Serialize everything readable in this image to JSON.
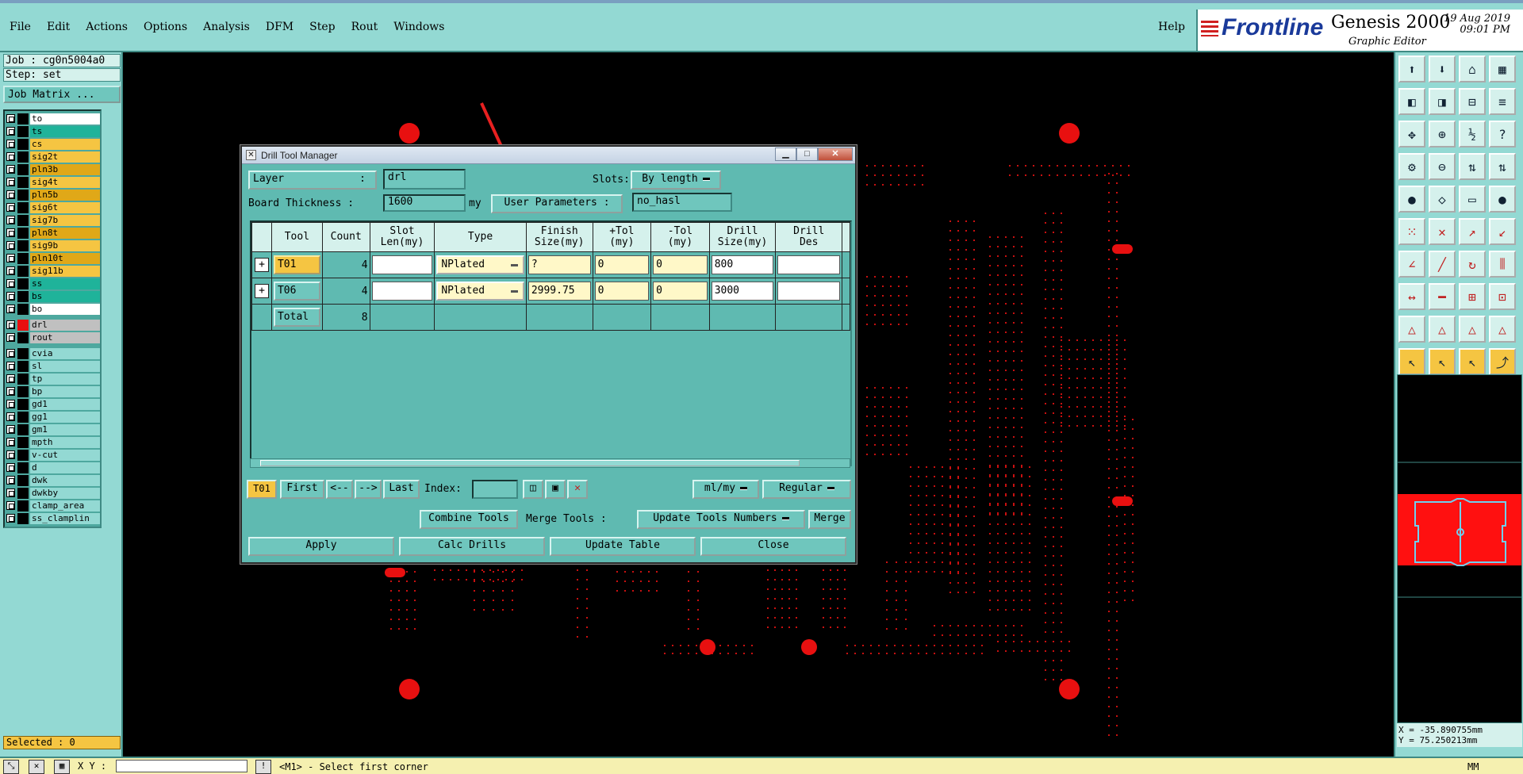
{
  "menubar": {
    "items": [
      "File",
      "Edit",
      "Actions",
      "Options",
      "Analysis",
      "DFM",
      "Step",
      "Rout",
      "Windows"
    ],
    "help": "Help"
  },
  "brand": {
    "logo": "Frontline",
    "product": "Genesis 2000",
    "subtitle": "Graphic Editor",
    "date": "19 Aug 2019",
    "time": "09:01 PM"
  },
  "left": {
    "job": "Job : cg0n5004a0",
    "step": "Step: set",
    "job_matrix": "Job Matrix ...",
    "layers": [
      {
        "name": "to",
        "color": "#ffffff"
      },
      {
        "name": "ts",
        "color": "#1fb39a"
      },
      {
        "name": "cs",
        "color": "#f5c542"
      },
      {
        "name": "sig2t",
        "color": "#f5c542"
      },
      {
        "name": "pln3b",
        "color": "#e0a818"
      },
      {
        "name": "sig4t",
        "color": "#f5c542"
      },
      {
        "name": "pln5b",
        "color": "#e0a818"
      },
      {
        "name": "sig6t",
        "color": "#f5c542"
      },
      {
        "name": "sig7b",
        "color": "#f5c542"
      },
      {
        "name": "pln8t",
        "color": "#e0a818"
      },
      {
        "name": "sig9b",
        "color": "#f5c542"
      },
      {
        "name": "pln10t",
        "color": "#e0a818"
      },
      {
        "name": "sig11b",
        "color": "#f5c542"
      },
      {
        "name": "ss",
        "color": "#1fb39a"
      },
      {
        "name": "bs",
        "color": "#1fb39a"
      },
      {
        "name": "bo",
        "color": "#ffffff"
      }
    ],
    "drill_layers": [
      {
        "name": "drl",
        "color": "#c0c0c0",
        "active": true
      },
      {
        "name": "rout",
        "color": "#c0c0c0",
        "active": false
      }
    ],
    "misc_layers": [
      "cvia",
      "sl",
      "tp",
      "bp",
      "gd1",
      "gg1",
      "gm1",
      "mpth",
      "v-cut",
      "d",
      "dwk",
      "dwkby",
      "clamp_area",
      "ss_clamplin"
    ],
    "selected": "Selected : 0"
  },
  "dialog": {
    "title": "Drill Tool Manager",
    "layer_label": "Layer",
    "layer_colon": ":",
    "layer_value": "drl",
    "slots_label": "Slots:",
    "slots_value": "By length",
    "board_thickness_label": "Board Thickness :",
    "board_thickness_value": "1600",
    "board_unit": "my",
    "user_params_label": "User Parameters :",
    "user_params_value": "no_hasl",
    "columns": [
      "Tool",
      "Count",
      "Slot\nLen(my)",
      "Type",
      "Finish\nSize(my)",
      "+Tol\n(my)",
      "-Tol\n(my)",
      "Drill\nSize(my)",
      "Drill\nDes"
    ],
    "rows": [
      {
        "tool": "T01",
        "count": "4",
        "slot_len": "",
        "type": "NPlated",
        "finish": "?",
        "ptol": "0",
        "ntol": "0",
        "drill": "800",
        "des": ""
      },
      {
        "tool": "T06",
        "count": "4",
        "slot_len": "",
        "type": "NPlated",
        "finish": "2999.75",
        "ptol": "0",
        "ntol": "0",
        "drill": "3000",
        "des": ""
      }
    ],
    "total_label": "Total",
    "total_count": "8",
    "current_tool": "T01",
    "first": "First",
    "prev": "<--",
    "next": "-->",
    "last": "Last",
    "index_label": "Index:",
    "unit_value": "ml/my",
    "mode_value": "Regular",
    "combine_tools": "Combine Tools",
    "merge_tools_label": "Merge Tools :",
    "update_tools_numbers": "Update Tools Numbers",
    "merge": "Merge",
    "apply": "Apply",
    "calc_drills": "Calc Drills",
    "update_table": "Update Table",
    "close": "Close"
  },
  "right": {
    "x_coord": "X = -35.890755mm",
    "y_coord": "Y = 75.250213mm"
  },
  "status": {
    "xy_label": "X Y :",
    "message": "<M1> - Select first corner",
    "units": "MM"
  },
  "colors": {
    "accent": "#93d9d3",
    "pad": "#e81010",
    "highlight": "#f5c542"
  }
}
